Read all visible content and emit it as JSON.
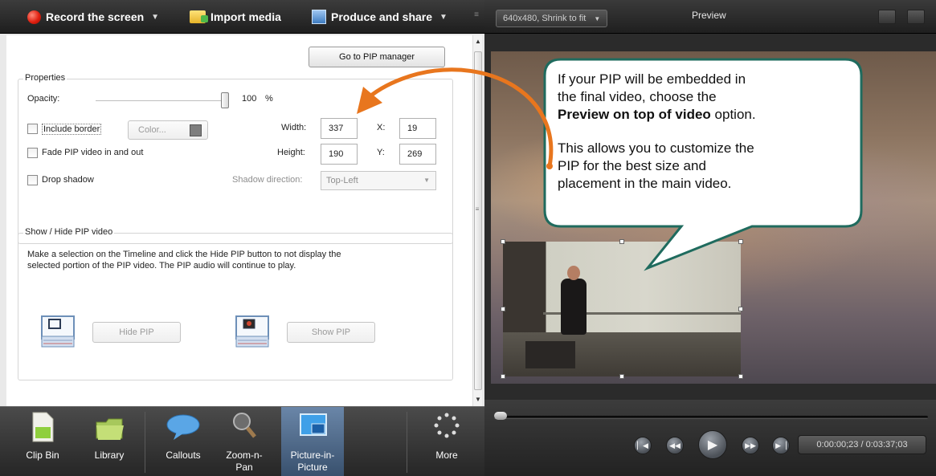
{
  "left_toolbar": {
    "record": "Record the screen",
    "import": "Import media",
    "produce": "Produce and share"
  },
  "pip_manager_button": "Go to PIP manager",
  "properties": {
    "title": "Properties",
    "opacity_label": "Opacity:",
    "opacity_value": "100",
    "opacity_unit": "%",
    "opacity_level": 1.0,
    "include_border": "Include border",
    "color_button": "Color...",
    "fade": "Fade PIP video in and out",
    "drop_shadow": "Drop shadow",
    "shadow_direction_label": "Shadow direction:",
    "shadow_direction_value": "Top-Left",
    "width_label": "Width:",
    "width_value": "337",
    "height_label": "Height:",
    "height_value": "190",
    "x_label": "X:",
    "x_value": "19",
    "y_label": "Y:",
    "y_value": "269"
  },
  "show_hide": {
    "title": "Show / Hide PIP video",
    "description_line1": "Make a selection on the Timeline and click the Hide PIP button to not display the",
    "description_line2": "selected portion of the PIP video. The PIP audio will continue to play.",
    "hide_button": "Hide PIP",
    "show_button": "Show PIP"
  },
  "tabs": [
    {
      "line1": "Clip Bin",
      "line2": ""
    },
    {
      "line1": "Library",
      "line2": ""
    },
    {
      "line1": "Callouts",
      "line2": ""
    },
    {
      "line1": "Zoom-n-",
      "line2": "Pan"
    },
    {
      "line1": "Picture-in-",
      "line2": "Picture"
    },
    {
      "line1": "More",
      "line2": ""
    }
  ],
  "right_toolbar": {
    "size_dropdown": "640x480, Shrink to fit",
    "preview_title": "Preview"
  },
  "callout": {
    "para1_line1": "If your PIP will be embedded in",
    "para1_line2": "the final video, choose the",
    "para1_bold": "Preview on top of video",
    "para1_after": " option.",
    "para2_line1": "This allows you to customize the",
    "para2_line2": "PIP for the best size and",
    "para2_line3": "placement in the main video."
  },
  "transport": {
    "timecode": "0:00:00;23 / 0:03:37;03",
    "position_fraction": 0.0
  },
  "colors": {
    "accent_orange": "#e8761e",
    "callout_border": "#1f6b5e",
    "active_tab": "#5a7597"
  }
}
